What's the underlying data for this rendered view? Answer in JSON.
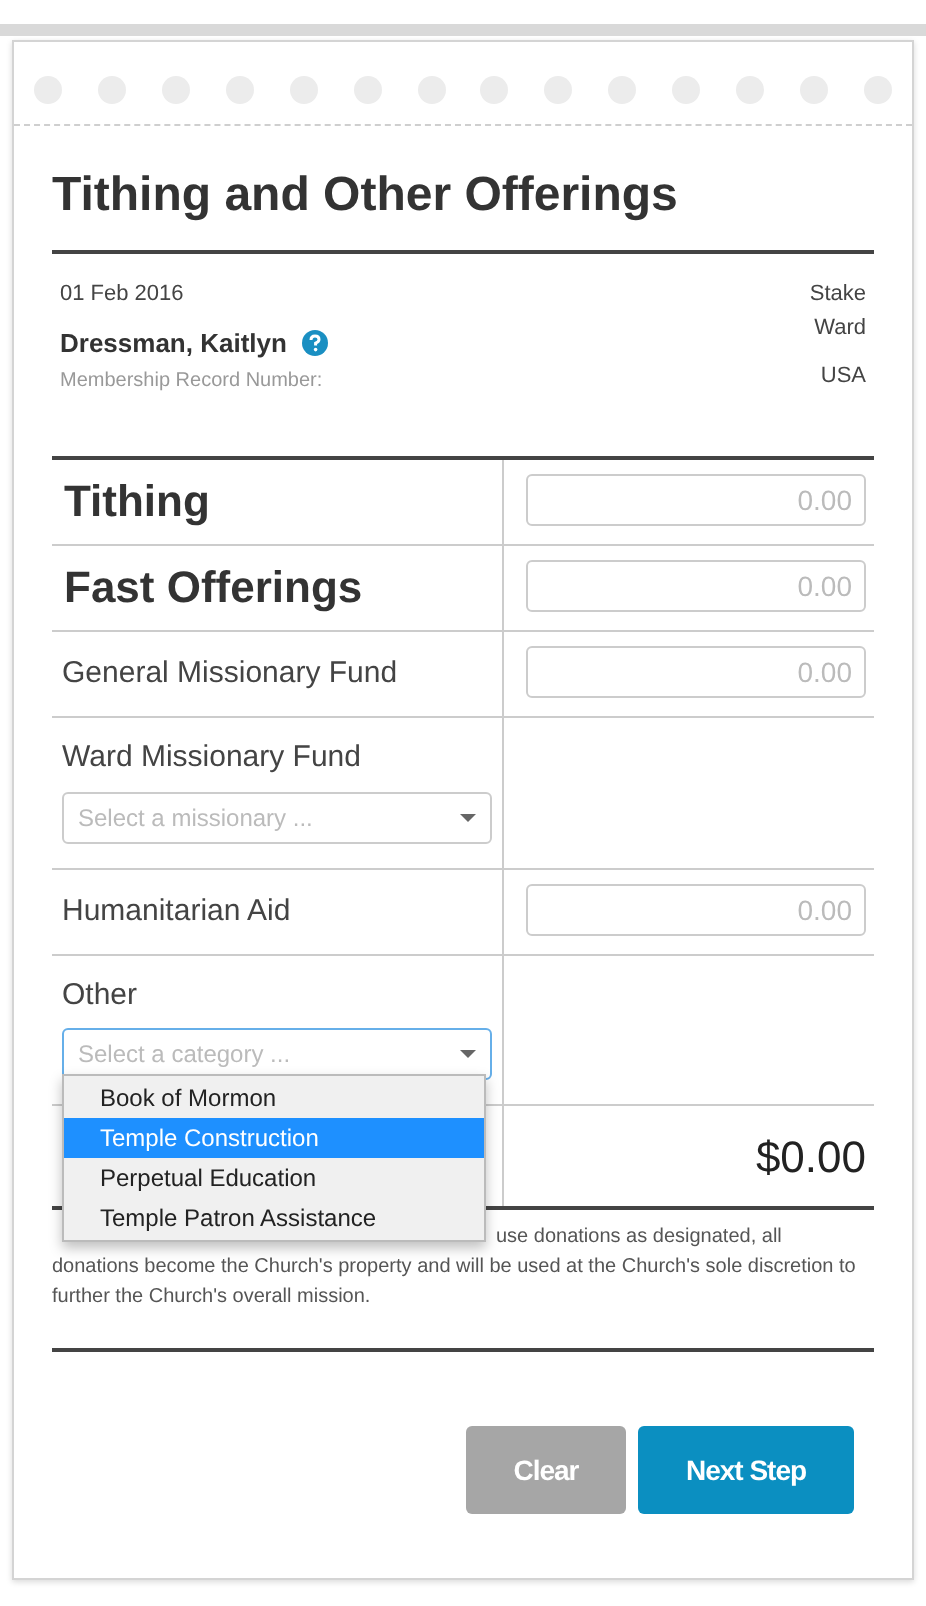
{
  "title": "Tithing and Other Offerings",
  "info": {
    "date": "01 Feb 2016",
    "name": "Dressman, Kaitlyn",
    "record_label": "Membership Record Number:",
    "stake": "Stake",
    "ward": "Ward",
    "country": "USA"
  },
  "rows": [
    {
      "kind": "major",
      "label": "Tithing",
      "placeholder": "0.00"
    },
    {
      "kind": "major",
      "label": "Fast Offerings",
      "placeholder": "0.00"
    },
    {
      "kind": "amount",
      "label": "General Missionary Fund",
      "placeholder": "0.00"
    },
    {
      "kind": "select",
      "label": "Ward Missionary Fund",
      "placeholder": "Select a missionary ...",
      "expanded": false
    },
    {
      "kind": "amount",
      "label": "Humanitarian Aid",
      "placeholder": "0.00"
    },
    {
      "kind": "select",
      "label": "Other",
      "placeholder": "Select a category ...",
      "expanded": true,
      "options": [
        {
          "label": "Book of Mormon",
          "selected": false
        },
        {
          "label": "Temple Construction",
          "selected": true
        },
        {
          "label": "Perpetual Education",
          "selected": false
        },
        {
          "label": "Temple Patron Assistance",
          "selected": false
        }
      ]
    }
  ],
  "total": "$0.00",
  "disclaimer": "use donations as designated, all donations become the Church's property and will be used at the Church's sole discretion to further the Church's overall mission.",
  "buttons": [
    {
      "kind": "secondary",
      "label": "Clear"
    },
    {
      "kind": "primary",
      "label": "Next Step"
    }
  ]
}
